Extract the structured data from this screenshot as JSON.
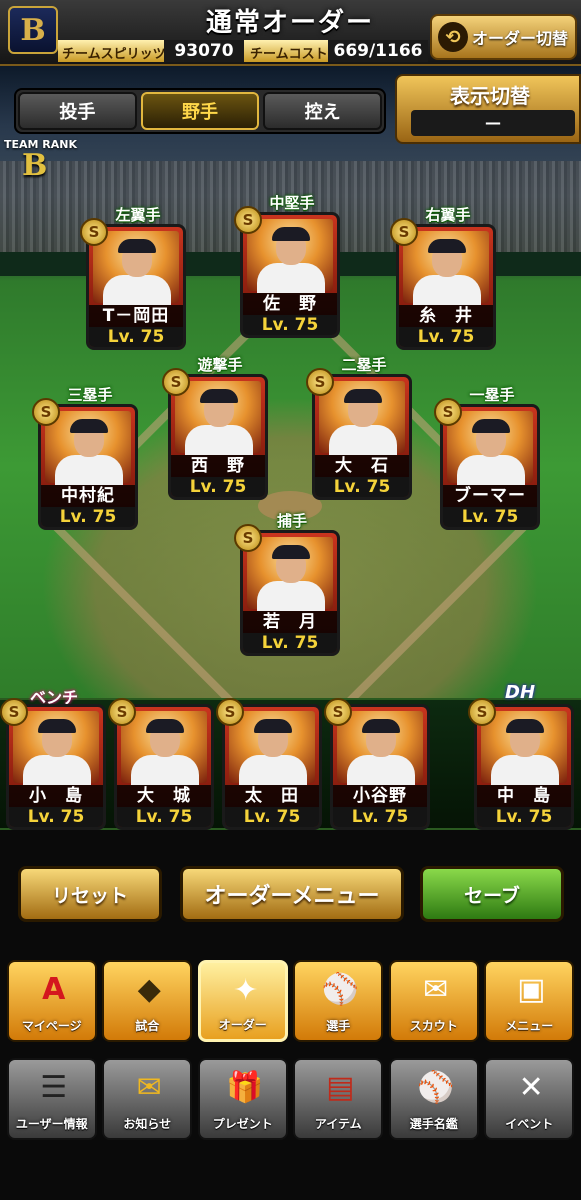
{
  "header": {
    "title": "通常オーダー",
    "logo": "B",
    "spirits_label": "チームスピリッツ",
    "spirits_value": "93070",
    "cost_label": "チームコスト",
    "cost_value": "669/1166",
    "switch_order_label": "オーダー切替"
  },
  "tabs": [
    "投手",
    "野手",
    "控え"
  ],
  "active_tab": "野手",
  "display_switch": {
    "label": "表示切替",
    "value": "—"
  },
  "team_rank": {
    "label": "TEAM RANK",
    "value": "B"
  },
  "fielders": [
    {
      "position": "左翼手",
      "name": "T－岡田",
      "level": "Lv. 75"
    },
    {
      "position": "中堅手",
      "name": "佐　野",
      "level": "Lv. 75"
    },
    {
      "position": "右翼手",
      "name": "糸　井",
      "level": "Lv. 75"
    },
    {
      "position": "遊撃手",
      "name": "西　野",
      "level": "Lv. 75"
    },
    {
      "position": "二塁手",
      "name": "大　石",
      "level": "Lv. 75"
    },
    {
      "position": "三塁手",
      "name": "中村紀",
      "level": "Lv. 75"
    },
    {
      "position": "一塁手",
      "name": "ブーマー",
      "level": "Lv. 75"
    },
    {
      "position": "捕手",
      "name": "若　月",
      "level": "Lv. 75"
    }
  ],
  "bench": {
    "label": "ベンチ",
    "dh_label": "DH",
    "players": [
      {
        "name": "小　島",
        "level": "Lv. 75"
      },
      {
        "name": "大　城",
        "level": "Lv. 75"
      },
      {
        "name": "太　田",
        "level": "Lv. 75"
      },
      {
        "name": "小谷野",
        "level": "Lv. 75"
      }
    ],
    "dh_player": {
      "name": "中　島",
      "level": "Lv. 75"
    }
  },
  "badge_glyph": "S",
  "actions": {
    "reset": "リセット",
    "order_menu": "オーダーメニュー",
    "save": "セーブ"
  },
  "nav_primary": [
    {
      "label": "マイページ",
      "icon": "A"
    },
    {
      "label": "試合",
      "icon": "◆"
    },
    {
      "label": "オーダー",
      "icon": "✦"
    },
    {
      "label": "選手",
      "icon": "⚾"
    },
    {
      "label": "スカウト",
      "icon": "✉"
    },
    {
      "label": "メニュー",
      "icon": "▣"
    }
  ],
  "nav_secondary": [
    {
      "label": "ユーザー情報",
      "icon": "☰"
    },
    {
      "label": "お知らせ",
      "icon": "✉"
    },
    {
      "label": "プレゼント",
      "icon": "🎁"
    },
    {
      "label": "アイテム",
      "icon": "▤"
    },
    {
      "label": "選手名鑑",
      "icon": "⚾"
    },
    {
      "label": "イベント",
      "icon": "✕"
    }
  ],
  "colors": {
    "gold": "#f0c55a",
    "level_yellow": "#f5d33a",
    "save_green": "#4fae2a"
  }
}
